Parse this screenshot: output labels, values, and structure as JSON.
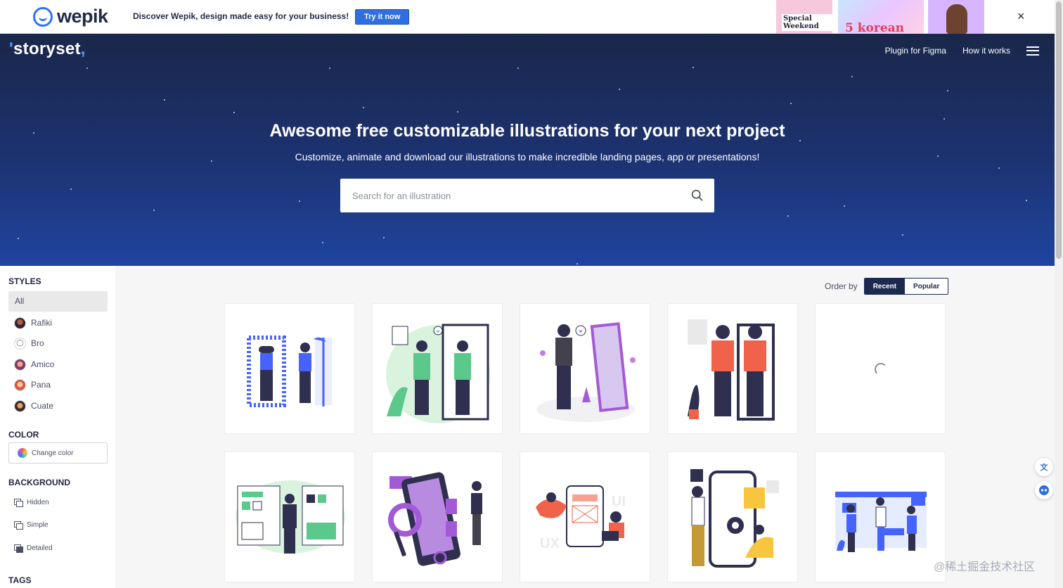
{
  "promo": {
    "brand": "wepik",
    "text": "Discover Wepik, design made easy for your business!",
    "cta": "Try it now",
    "art_text_1": "Special Weekend",
    "art_text_2": "5 korean",
    "close": "×"
  },
  "header": {
    "logo": "storyset",
    "nav": [
      "Plugin for Figma",
      "How it works"
    ]
  },
  "hero": {
    "title": "Awesome free customizable illustrations for your next project",
    "subtitle": "Customize, animate and download our illustrations to make incredible landing pages, app or presentations!",
    "search_placeholder": "Search for an illustration"
  },
  "sidebar": {
    "styles_heading": "STYLES",
    "styles": [
      "All",
      "Rafiki",
      "Bro",
      "Amico",
      "Pana",
      "Cuate"
    ],
    "color_heading": "COLOR",
    "color_button": "Change color",
    "background_heading": "BACKGROUND",
    "backgrounds": [
      "Hidden",
      "Simple",
      "Detailed"
    ],
    "tags_heading": "TAGS"
  },
  "order": {
    "label": "Order by",
    "options": [
      "Recent",
      "Popular"
    ],
    "selected": "Recent"
  },
  "illustrations": {
    "row1_count": 5,
    "row2_count": 5,
    "loading_index": 4
  },
  "watermark": "@稀土掘金技术社区",
  "colors": {
    "hero_top": "#1a274a",
    "hero_bottom": "#1f44a0",
    "accent": "#2f6fe0",
    "dark": "#1c2a4f"
  }
}
